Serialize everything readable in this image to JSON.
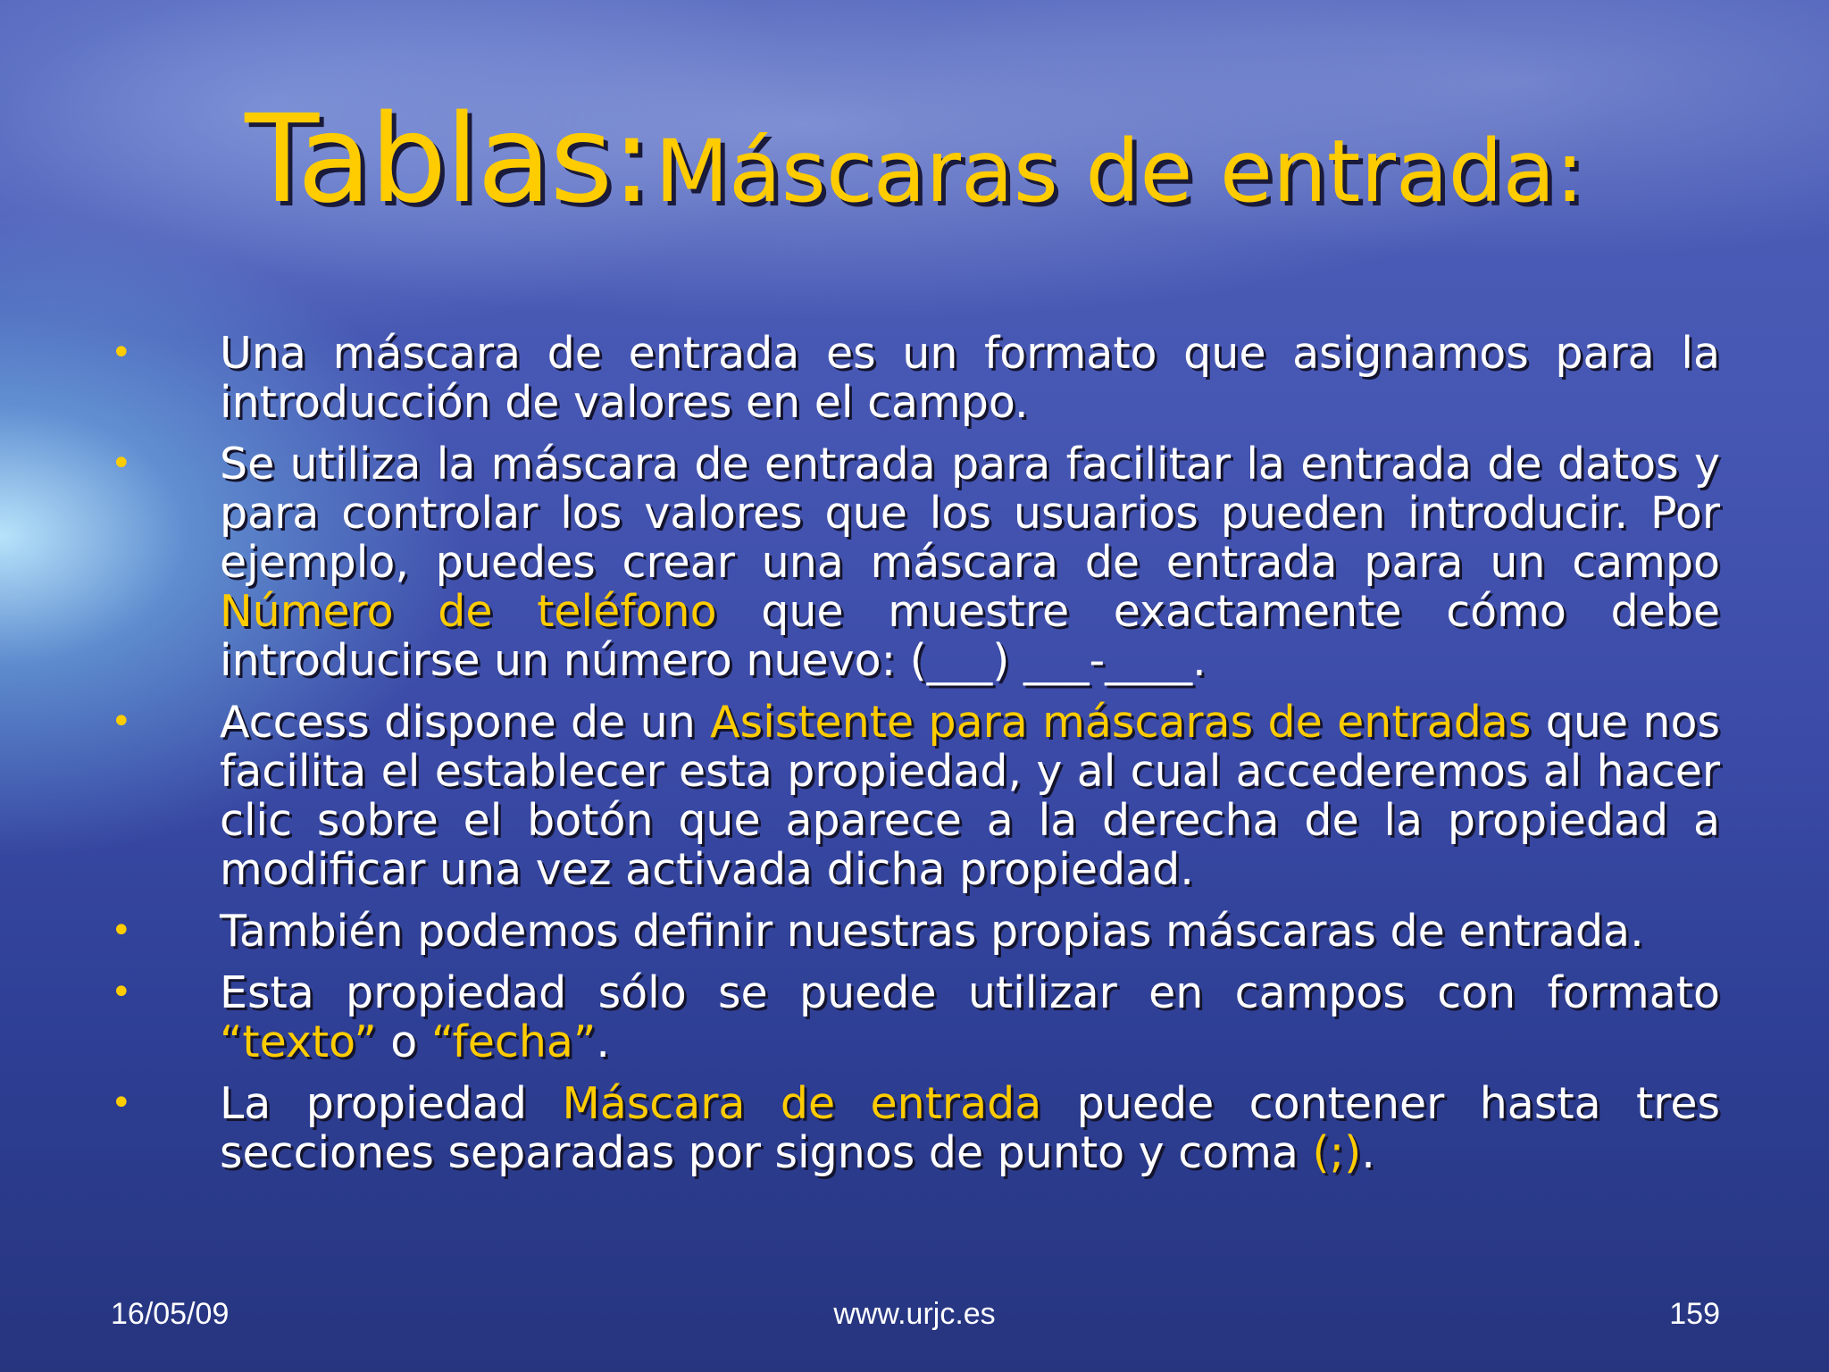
{
  "title": {
    "main": "Tablas:",
    "sub": "Máscaras de entrada:"
  },
  "bullets": [
    {
      "t1": "Una máscara de entrada es un formato que asignamos para la introducción de valores en el campo."
    },
    {
      "t1": "Se utiliza la máscara de entrada para facilitar la entrada de datos y para controlar los valores que los usuarios pueden introducir. Por ejemplo, puedes crear una máscara de entrada para un campo ",
      "h1": "Número de teléfono",
      "t2": " que muestre exactamente cómo debe introducirse un número nuevo: (___) ___-____."
    },
    {
      "t1": "Access dispone de un ",
      "h1": "Asistente para máscaras de entradas",
      "t2": " que nos facilita el establecer esta propiedad, y al cual accederemos al hacer clic sobre el botón    que aparece a la derecha de la propiedad a modificar una vez activada dicha propiedad."
    },
    {
      "t1": "También podemos definir nuestras propias máscaras de entrada."
    },
    {
      "t1": "Esta propiedad sólo se puede utilizar en campos con formato ",
      "h1": "“texto”",
      "t2": " o ",
      "h2": "“fecha”",
      "t3": "."
    },
    {
      "t1": "La propiedad ",
      "h1": "Máscara de entrada",
      "t2": " puede contener hasta tres secciones separadas por signos de punto y coma ",
      "h2": "(;)",
      "t3": "."
    }
  ],
  "bullet_symbol": "•",
  "footer": {
    "date": "16/05/09",
    "url": "www.urjc.es",
    "page": "159"
  },
  "colors": {
    "title": "#ffcc00",
    "highlight": "#ffcc00",
    "text": "#ffffff"
  }
}
